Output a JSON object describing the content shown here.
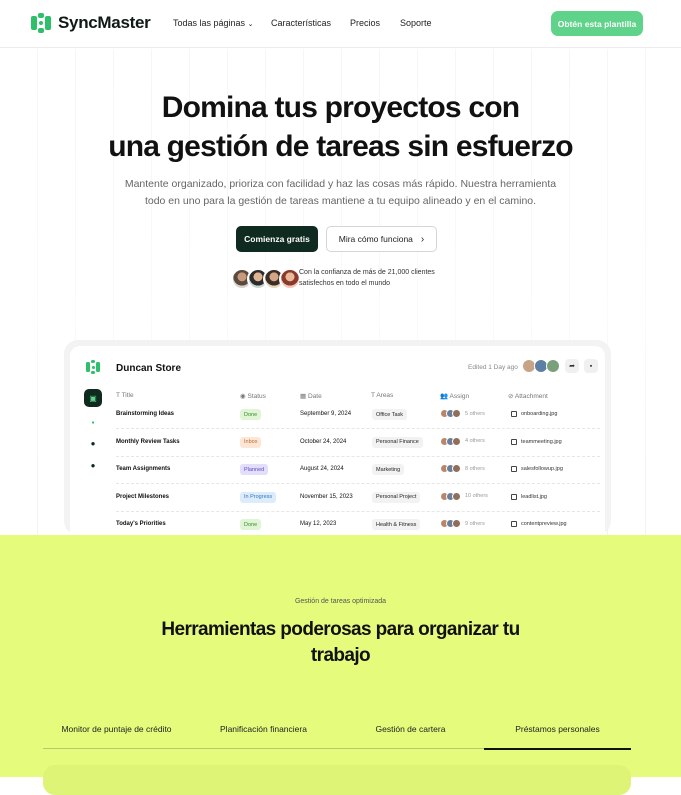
{
  "brand": {
    "name": "SyncMaster",
    "accent": "#2fbf6b",
    "lime": "#e5fb7c",
    "dark": "#0f2a1e"
  },
  "nav": {
    "links": [
      "Todas las páginas",
      "Características",
      "Precios",
      "Soporte"
    ],
    "cta": "Obtén esta plantilla"
  },
  "hero": {
    "title_line1": "Domina tus proyectos con",
    "title_line2": "una gestión de tareas sin esfuerzo",
    "subtitle_line1": "Mantente organizado, prioriza con facilidad y haz las cosas más rápido. Nuestra herramienta",
    "subtitle_line2": "todo en uno para la gestión de tareas mantiene a tu equipo alineado y en el camino.",
    "primary_button": "Comienza gratis",
    "secondary_button": "Mira cómo funciona",
    "trust_line1": "Con la confianza de más de 21,000 clientes",
    "trust_line2": "satisfechos en todo el mundo"
  },
  "app": {
    "store": "Duncan Store",
    "edited": "Edited 1 Day ago",
    "columns": [
      "Title",
      "Status",
      "Date",
      "Areas",
      "Assign",
      "Attachment"
    ],
    "rows": [
      {
        "title": "Brainstorming Ideas",
        "status": "Done",
        "status_bg": "#dff5d6",
        "status_fg": "#3a8a2a",
        "date": "September 9, 2024",
        "area": "Office Task",
        "assign": "5 others",
        "file": "onboarding.jpg"
      },
      {
        "title": "Monthly Review Tasks",
        "status": "Inbox",
        "status_bg": "#fde6d6",
        "status_fg": "#c0692e",
        "date": "October 24, 2024",
        "area": "Personal Finance",
        "assign": "4 others",
        "file": "teammeeting.jpg"
      },
      {
        "title": "Team Assignments",
        "status": "Planned",
        "status_bg": "#e2defb",
        "status_fg": "#5a4fc4",
        "date": "August 24, 2024",
        "area": "Marketing",
        "assign": "8 others",
        "file": "salesfollowup.jpg"
      },
      {
        "title": "Project Milestones",
        "status": "In Progress",
        "status_bg": "#dcecfb",
        "status_fg": "#2f78c2",
        "date": "November 15, 2023",
        "area": "Personal Project",
        "assign": "10 others",
        "file": "leadlist.jpg"
      },
      {
        "title": "Today's Priorities",
        "status": "Done",
        "status_bg": "#dff5d6",
        "status_fg": "#3a8a2a",
        "date": "May 12, 2023",
        "area": "Health & Fitness",
        "assign": "9 others",
        "file": "contentpreview.jpg"
      }
    ]
  },
  "features": {
    "eyebrow": "Gestión de tareas optimizada",
    "title_line1": "Herramientas poderosas para organizar tu",
    "title_line2": "trabajo",
    "tabs": [
      "Monitor de puntaje de crédito",
      "Planificación financiera",
      "Gestión de cartera",
      "Préstamos personales"
    ],
    "active_tab": "Préstamos personales"
  }
}
